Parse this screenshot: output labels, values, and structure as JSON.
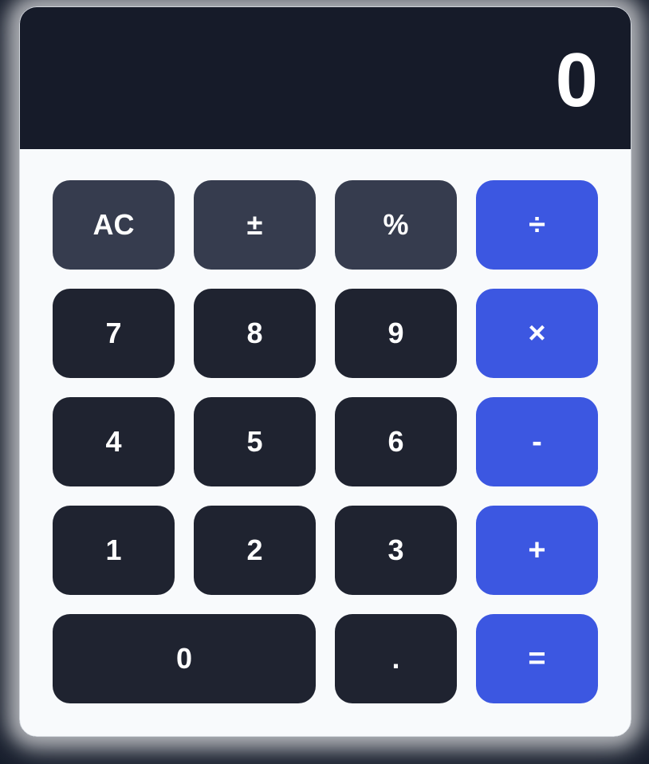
{
  "display": {
    "value": "0"
  },
  "keys": {
    "clear": "AC",
    "sign": "±",
    "percent": "%",
    "divide": "÷",
    "seven": "7",
    "eight": "8",
    "nine": "9",
    "multiply": "×",
    "four": "4",
    "five": "5",
    "six": "6",
    "subtract": "-",
    "one": "1",
    "two": "2",
    "three": "3",
    "add": "+",
    "zero": "0",
    "decimal": ".",
    "equals": "="
  },
  "colors": {
    "display_bg": "#161b29",
    "function_key": "#363c4e",
    "number_key": "#1f2330",
    "operator_key": "#3c57e1",
    "panel_bg": "#f8fafc"
  }
}
